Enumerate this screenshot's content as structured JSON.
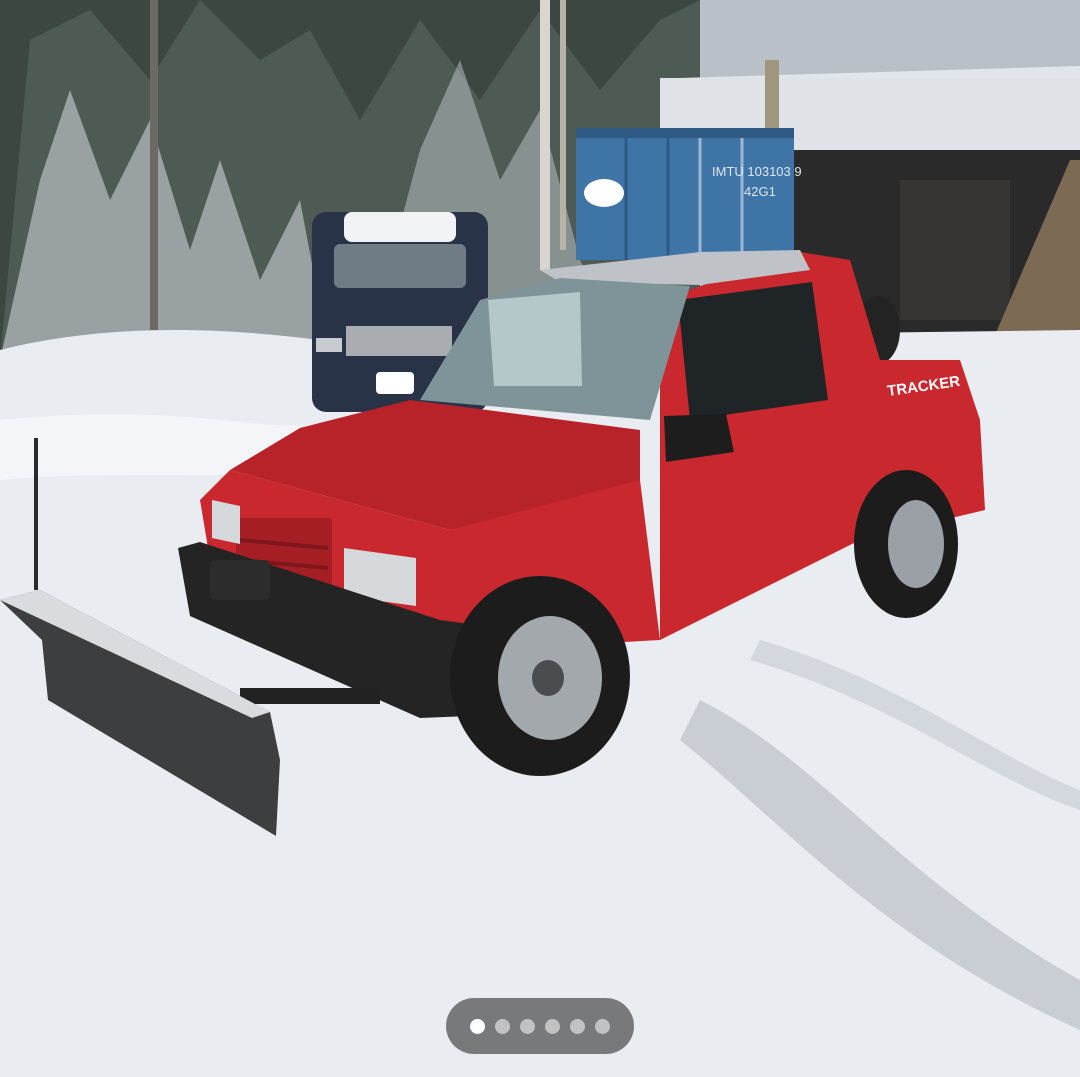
{
  "viewer": {
    "photo_label": "Red Geo Tracker with front snow plow parked in a snowy driveway",
    "truck_badge": "TRACKER",
    "container_code": "IMTU 103103 9",
    "container_type": "42G1"
  },
  "pager": {
    "count": 6,
    "active_index": 0
  },
  "colors": {
    "truck_red": "#c8282e",
    "snow": "#e9edf2",
    "container_blue": "#3f74a6",
    "pager_bg": "#5f5f5f"
  }
}
